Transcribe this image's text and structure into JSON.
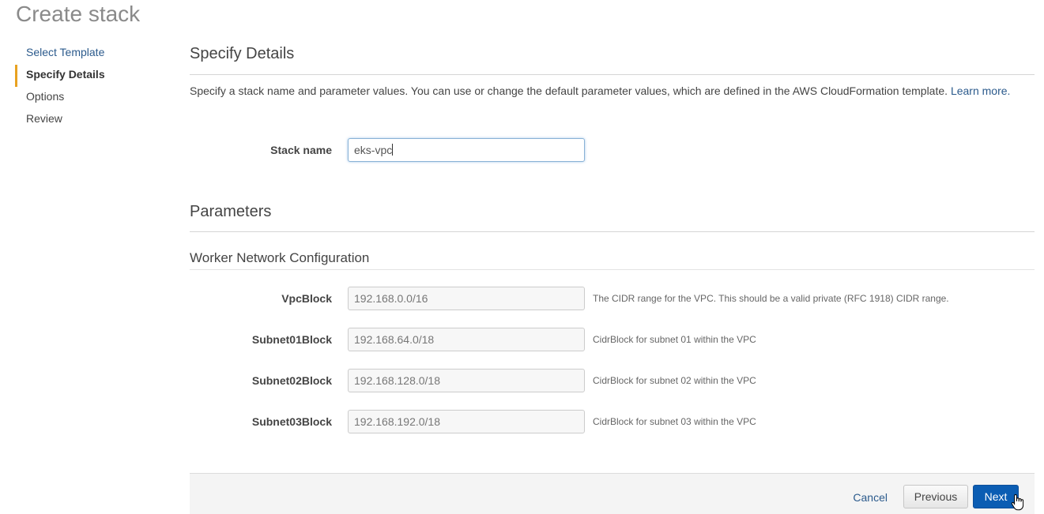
{
  "page": {
    "title": "Create stack"
  },
  "steps": [
    {
      "label": "Select Template",
      "state": "link"
    },
    {
      "label": "Specify Details",
      "state": "active"
    },
    {
      "label": "Options",
      "state": "default"
    },
    {
      "label": "Review",
      "state": "default"
    }
  ],
  "details": {
    "title": "Specify Details",
    "description": "Specify a stack name and parameter values. You can use or change the default parameter values, which are defined in the AWS CloudFormation template.",
    "learn_more": "Learn more.",
    "stack_name_label": "Stack name",
    "stack_name_value": "eks-vpc"
  },
  "parameters": {
    "title": "Parameters",
    "group_title": "Worker Network Configuration",
    "fields": [
      {
        "label": "VpcBlock",
        "value": "192.168.0.0/16",
        "help": "The CIDR range for the VPC. This should be a valid private (RFC 1918) CIDR range."
      },
      {
        "label": "Subnet01Block",
        "value": "192.168.64.0/18",
        "help": "CidrBlock for subnet 01 within the VPC"
      },
      {
        "label": "Subnet02Block",
        "value": "192.168.128.0/18",
        "help": "CidrBlock for subnet 02 within the VPC"
      },
      {
        "label": "Subnet03Block",
        "value": "192.168.192.0/18",
        "help": "CidrBlock for subnet 03 within the VPC"
      }
    ]
  },
  "footer": {
    "cancel_label": "Cancel",
    "previous_label": "Previous",
    "next_label": "Next"
  },
  "colors": {
    "accent": "#e8a221",
    "link": "#2b5a8c",
    "primary_button": "#0b5db3"
  }
}
